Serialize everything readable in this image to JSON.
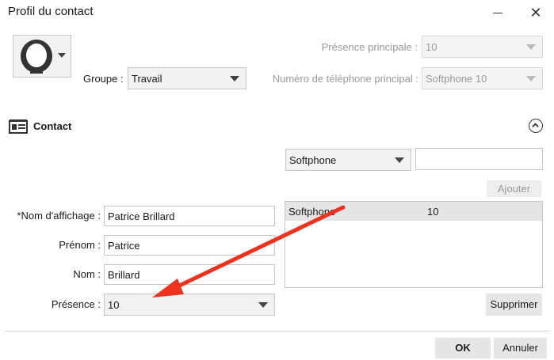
{
  "window": {
    "title": "Profil du contact"
  },
  "header": {
    "group_label": "Groupe :",
    "group_value": "Travail",
    "presence_principale_label": "Présence principale :",
    "presence_principale_value": "10",
    "phone_principal_label": "Numéro de téléphone principal :",
    "phone_principal_value": "Softphone 10"
  },
  "contact": {
    "section_title": "Contact",
    "display_name_label": "*Nom d'affichage :",
    "display_name_value": "Patrice Brillard",
    "first_name_label": "Prénom :",
    "first_name_value": "Patrice",
    "last_name_label": "Nom :",
    "last_name_value": "Brillard",
    "presence_label": "Présence :",
    "presence_value": "10"
  },
  "phones": {
    "type_value": "Softphone",
    "number_value": "",
    "add_label": "Ajouter",
    "remove_label": "Supprimer",
    "rows": [
      {
        "type": "Softphone",
        "number": "10"
      }
    ]
  },
  "footer": {
    "ok_label": "OK",
    "cancel_label": "Annuler"
  },
  "colors": {
    "annotation_arrow": "#f0311e",
    "control_bg": "#f2f2f2",
    "selected_row_bg": "#e5e5e5"
  },
  "icons": [
    "avatar-icon",
    "contact-card-icon",
    "chevron-up-icon",
    "minimize-icon",
    "close-icon"
  ]
}
